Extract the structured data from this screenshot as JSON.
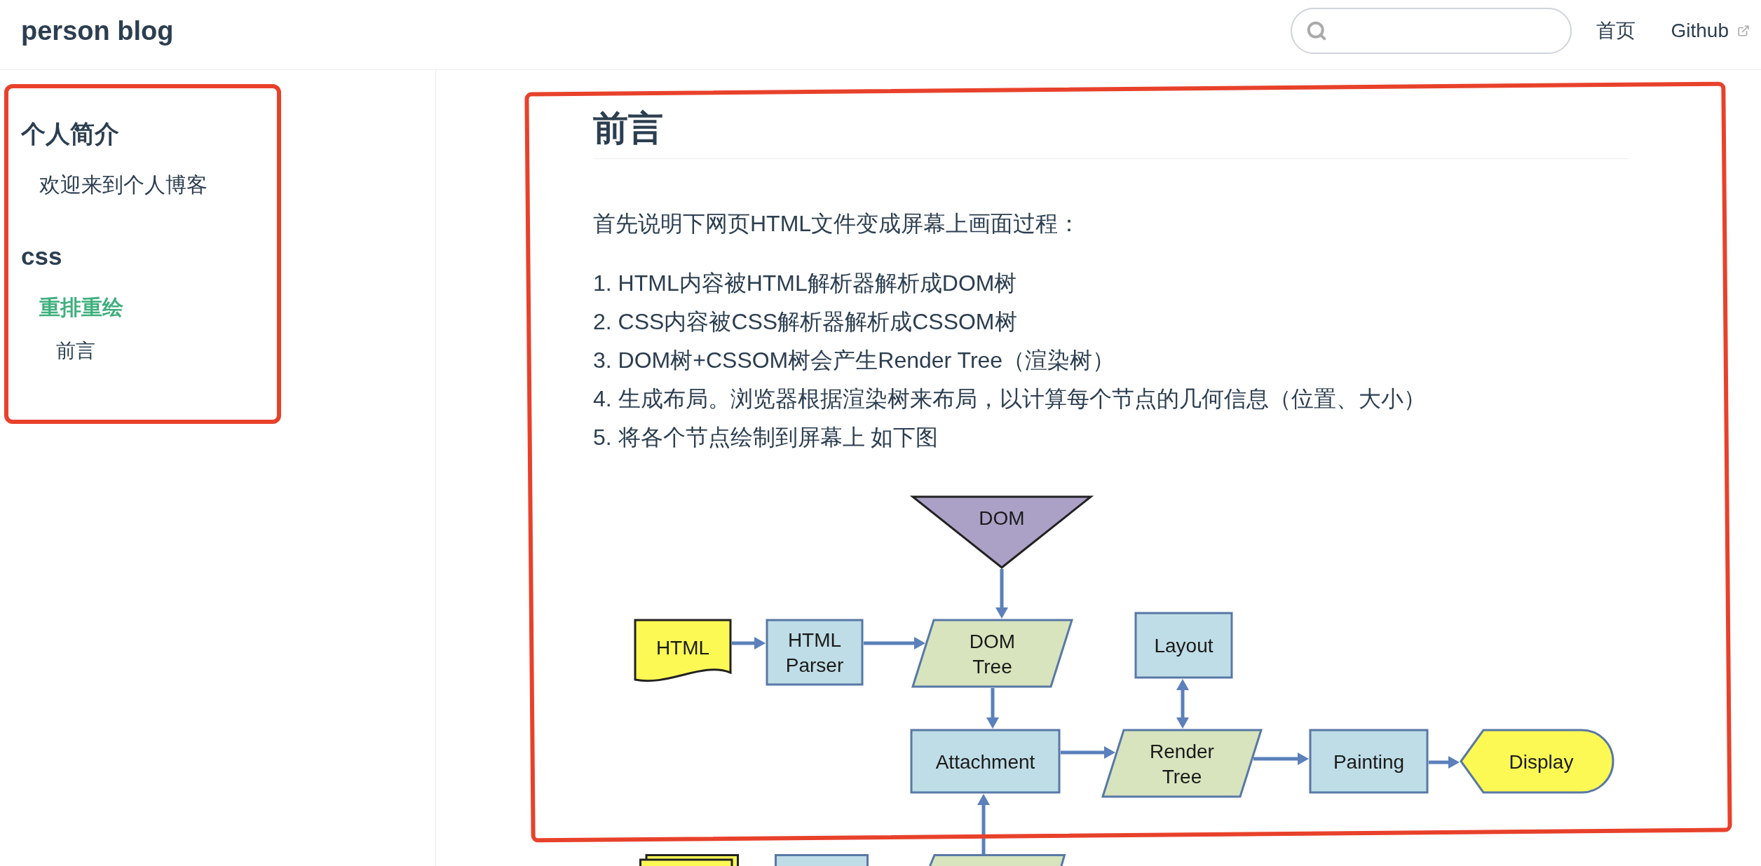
{
  "header": {
    "site_title": "person blog",
    "nav_links": [
      {
        "label": "首页",
        "external": false
      },
      {
        "label": "Github",
        "external": true
      }
    ]
  },
  "sidebar": {
    "highlighted": true,
    "groups": [
      {
        "title": "个人简介",
        "items": [
          {
            "label": "欢迎来到个人博客",
            "selected": false
          }
        ]
      },
      {
        "title": "css",
        "items": [
          {
            "label": "重排重绘",
            "selected": true,
            "children": [
              {
                "label": "前言",
                "selected": false
              }
            ]
          }
        ]
      }
    ]
  },
  "article": {
    "highlighted": true,
    "heading": "前言",
    "intro": "首先说明下网页HTML文件变成屏幕上画面过程：",
    "steps": [
      "1. HTML内容被HTML解析器解析成DOM树",
      "2. CSS内容被CSS解析器解析成CSSOM树",
      "3. DOM树+CSSOM树会产生Render Tree（渲染树）",
      "4. 生成布局。浏览器根据渲染树来布局，以计算每个节点的几何信息（位置、大小）",
      "5. 将各个节点绘制到屏幕上 如下图"
    ],
    "figure": {
      "nodes": [
        {
          "kind": "triangle",
          "lines": [
            "DOM"
          ]
        },
        {
          "kind": "document",
          "lines": [
            "HTML"
          ]
        },
        {
          "kind": "process",
          "lines": [
            "HTML",
            "Parser"
          ]
        },
        {
          "kind": "data",
          "lines": [
            "DOM",
            "Tree"
          ]
        },
        {
          "kind": "process",
          "lines": [
            "Layout"
          ]
        },
        {
          "kind": "process",
          "lines": [
            "Attachment"
          ]
        },
        {
          "kind": "data",
          "lines": [
            "Render",
            "Tree"
          ]
        },
        {
          "kind": "process",
          "lines": [
            "Painting"
          ]
        },
        {
          "kind": "display",
          "lines": [
            "Display"
          ]
        },
        {
          "kind": "stacked-document-cut"
        },
        {
          "kind": "process-cut"
        },
        {
          "kind": "data-cut"
        }
      ]
    }
  }
}
